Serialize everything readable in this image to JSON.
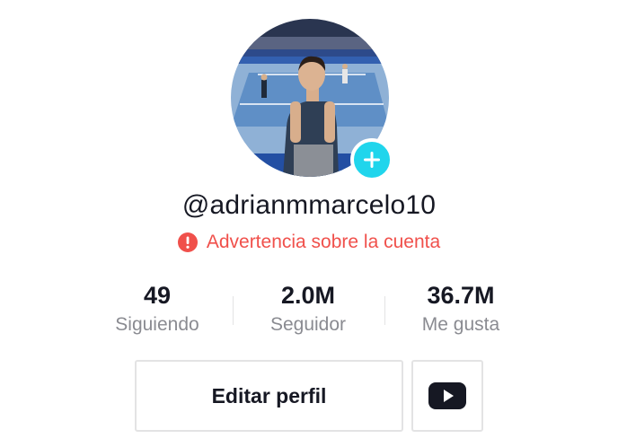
{
  "profile": {
    "username": "@adrianmmarcelo10",
    "warning_text": "Advertencia sobre la cuenta",
    "avatar_icon": "profile-photo",
    "add_icon": "plus-icon",
    "warning_icon": "alert-circle-icon"
  },
  "stats": [
    {
      "value": "49",
      "label": "Siguiendo"
    },
    {
      "value": "2.0M",
      "label": "Seguidor"
    },
    {
      "value": "36.7M",
      "label": "Me gusta"
    }
  ],
  "actions": {
    "edit_label": "Editar perfil",
    "youtube_icon": "youtube-icon"
  },
  "colors": {
    "accent": "#20d5ec",
    "warning": "#f0504b",
    "text": "#161823",
    "muted": "#8a8b91"
  }
}
